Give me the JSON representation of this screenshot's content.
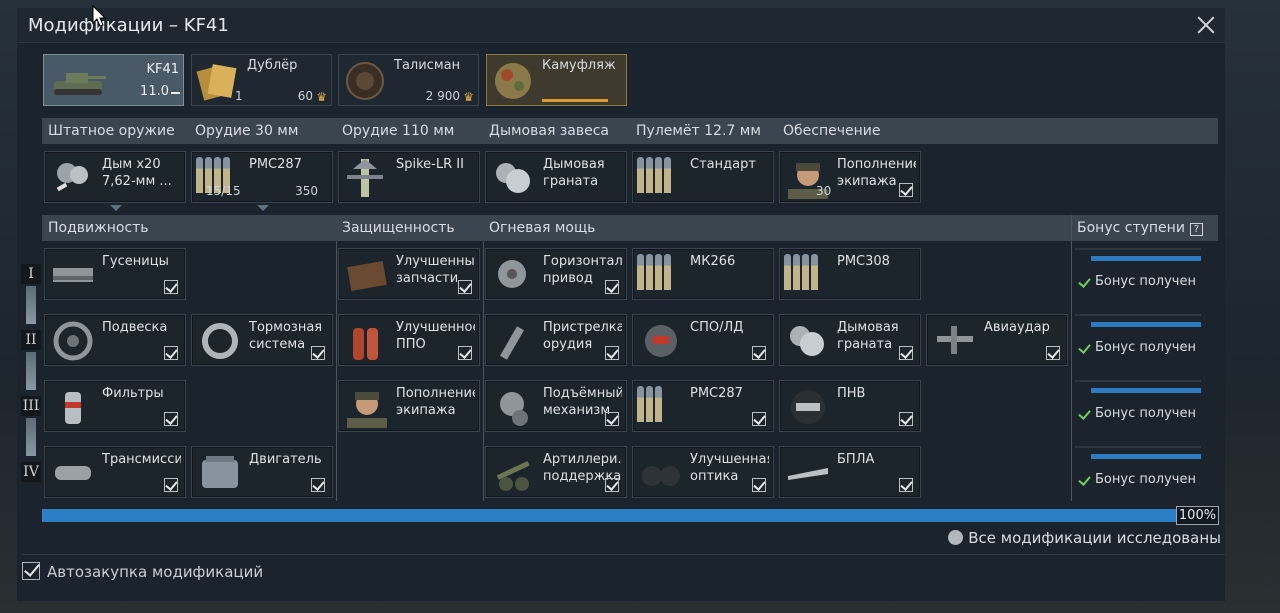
{
  "window": {
    "title": "Модификации – KF41"
  },
  "top_slots": {
    "vehicle": {
      "name": "KF41",
      "br": "11.0"
    },
    "crew": {
      "label": "Дублёр",
      "count": "1",
      "price": "60"
    },
    "talisman": {
      "label": "Талисман",
      "price": "2 900"
    },
    "camo": {
      "label": "Камуфляж"
    }
  },
  "weapons_row": {
    "headers": [
      "Штатное оружие",
      "Орудие 30 мм",
      "Орудие 110 мм",
      "Дымовая завеса",
      "Пулемёт 12.7 мм",
      "Обеспечение"
    ],
    "tiles": [
      {
        "label": "Дым x20\n7,62-мм ...",
        "icon": "smoke-wrench-icon"
      },
      {
        "label": "PMC287",
        "icon": "ammo-belt-icon",
        "ammo": "15/15",
        "price": "350"
      },
      {
        "label": "Spike-LR II",
        "icon": "missile-icon"
      },
      {
        "label": "Дымовая\nграната",
        "icon": "smoke-grenade-icon"
      },
      {
        "label": "Стандарт",
        "icon": "mg-ammo-icon"
      },
      {
        "label": "Пополнение\nэкипажа",
        "icon": "crew-replenish-icon",
        "count": "30"
      }
    ]
  },
  "mod_headers": [
    "Подвижность",
    "Защищенность",
    "Огневая мощь",
    "Бонус ступени"
  ],
  "tiers": [
    "I",
    "II",
    "III",
    "IV"
  ],
  "mobility": [
    {
      "label": "Гусеницы",
      "icon": "tracks-icon"
    },
    {
      "label": "Подвеска",
      "icon": "suspension-icon"
    },
    {
      "label": "Тормозная\nсистема",
      "icon": "brake-icon"
    },
    {
      "label": "Фильтры",
      "icon": "filter-icon"
    },
    {
      "label": "Трансмиссия",
      "icon": "transmission-icon"
    },
    {
      "label": "Двигатель",
      "icon": "engine-icon"
    }
  ],
  "protection": [
    {
      "label": "Улучшенные\nзапчасти",
      "icon": "parts-icon"
    },
    {
      "label": "Улучшенное\nППО",
      "icon": "extinguisher-icon"
    },
    {
      "label": "Пополнение\nэкипажа",
      "icon": "crew-icon"
    }
  ],
  "firepower": [
    {
      "label": "Горизонтал...\nпривод",
      "icon": "turret-drive-icon"
    },
    {
      "label": "МК266",
      "icon": "mk266-ammo-icon"
    },
    {
      "label": "PMC308",
      "icon": "pmc308-ammo-icon"
    },
    {
      "label": "Пристрелка\nорудия",
      "icon": "zeroing-icon"
    },
    {
      "label": "СПО/ЛД",
      "icon": "laser-warning-icon"
    },
    {
      "label": "Дымовая\nграната",
      "icon": "smoke-grenade-icon"
    },
    {
      "label": "Авиаудар",
      "icon": "airstrike-icon"
    },
    {
      "label": "Подъёмный\nмеханизм",
      "icon": "elevation-icon"
    },
    {
      "label": "PMC287",
      "icon": "pmc287-ammo-icon"
    },
    {
      "label": "ПНВ",
      "icon": "nightvision-icon"
    },
    {
      "label": "Артиллери...\nподдержка",
      "icon": "artillery-icon"
    },
    {
      "label": "Улучшенная\nоптика",
      "icon": "binoculars-icon"
    },
    {
      "label": "БПЛА",
      "icon": "drone-icon"
    }
  ],
  "tier_bonus": {
    "text": "Бонус получен"
  },
  "progress": {
    "percent_label": "100%",
    "value": 1.0
  },
  "research_status": "Все модификации исследованы",
  "auto_purchase": "Автозакупка модификаций",
  "colors": {
    "accent": "#2c7fc4",
    "check": "#6fcf5c",
    "gold": "#e0b040"
  }
}
